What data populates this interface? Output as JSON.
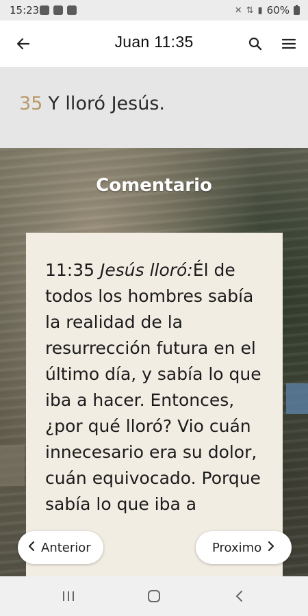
{
  "status_bar": {
    "time": "15:23",
    "battery": "60%",
    "icons": [
      "whatsapp-icon",
      "gallery-icon",
      "gmail-icon",
      "mute-icon",
      "data-icon",
      "signal-icon",
      "battery-icon"
    ]
  },
  "app_bar": {
    "title": "Juan 11:35",
    "icons": [
      "back-arrow-icon",
      "search-icon",
      "menu-icon"
    ]
  },
  "verse": {
    "number": "35",
    "text": "Y lloró Jesús."
  },
  "commentary": {
    "heading": "Comentario",
    "ref": "11:35",
    "emphasis": "Jesús lloró:",
    "body": "Él de todos los hombres sabía la realidad de la resurrección futura en el último día, y sabía lo que iba a hacer. Entonces, ¿por qué lloró? Vio cuán innecesario era su dolor, cuán equivocado. Porque sabía lo que iba a"
  },
  "nav": {
    "prev_label": "Anterior",
    "next_label": "Proximo"
  },
  "system_nav": [
    "recents-icon",
    "home-icon",
    "back-icon"
  ],
  "colors": {
    "verse_number": "#b89a6a",
    "card_bg": "#f2ede3",
    "verse_bg": "#e6e6e6"
  }
}
